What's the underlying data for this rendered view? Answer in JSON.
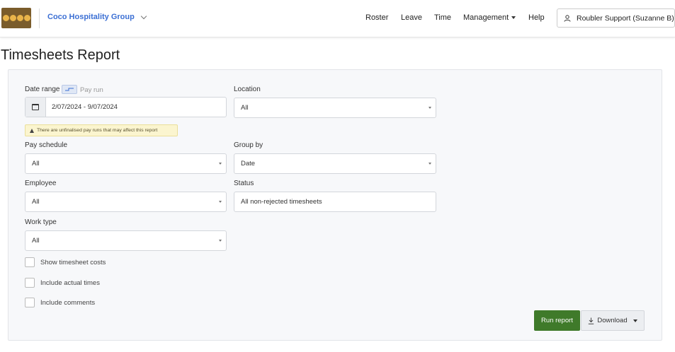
{
  "header": {
    "org_name": "Coco Hospitality Group",
    "nav": [
      {
        "label": "Roster"
      },
      {
        "label": "Leave"
      },
      {
        "label": "Time"
      },
      {
        "label": "Management"
      },
      {
        "label": "Help"
      }
    ],
    "user_label": "Roubler Support (Suzanne B)"
  },
  "page": {
    "title": "Timesheets Report"
  },
  "form": {
    "date_range_label": "Date range",
    "pay_run_label": "Pay run",
    "date_range_value": "2/07/2024 - 9/07/2024",
    "warning_text": "There are unfinalised pay runs that may affect this report",
    "location_label": "Location",
    "location_value": "All",
    "pay_schedule_label": "Pay schedule",
    "pay_schedule_value": "All",
    "group_by_label": "Group by",
    "group_by_value": "Date",
    "employee_label": "Employee",
    "employee_value": "All",
    "status_label": "Status",
    "status_value": "All non-rejected timesheets",
    "work_type_label": "Work type",
    "work_type_value": "All",
    "checkboxes": [
      {
        "label": "Show timesheet costs"
      },
      {
        "label": "Include actual times"
      },
      {
        "label": "Include comments"
      }
    ],
    "run_report_label": "Run report",
    "download_label": "Download"
  },
  "colors": {
    "brand_blue": "#3b6fd4",
    "run_green": "#3f7a2a",
    "logo_brown": "#7a5c2b"
  }
}
